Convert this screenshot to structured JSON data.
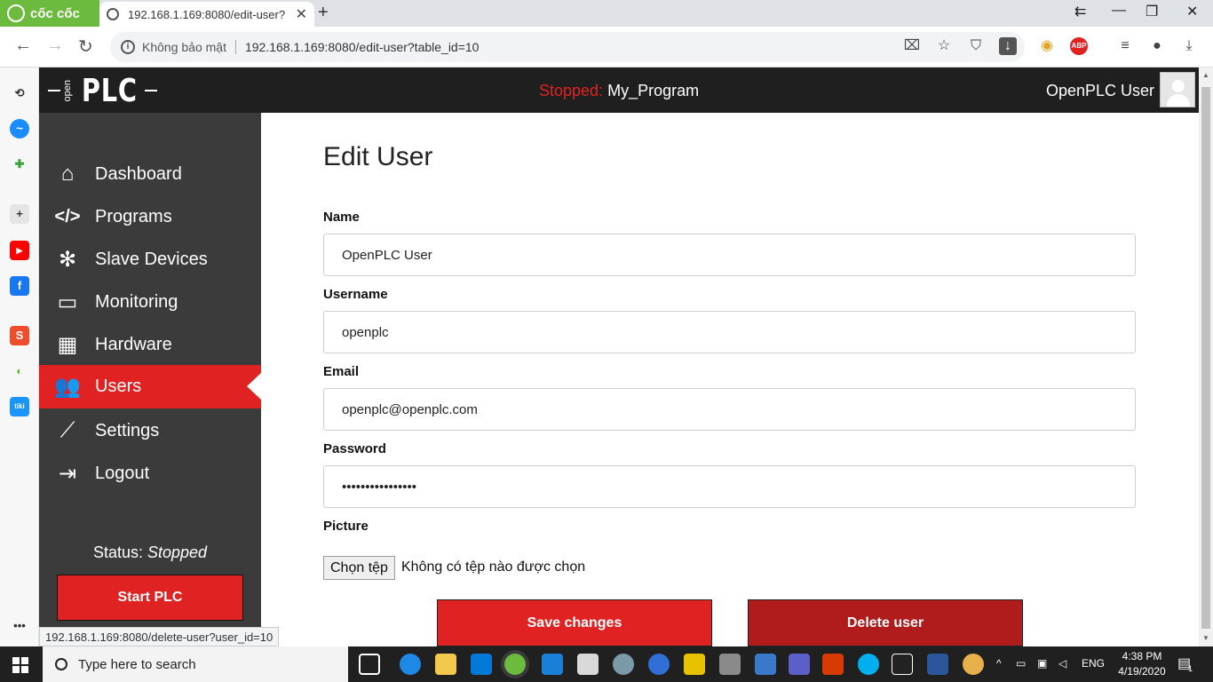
{
  "browser": {
    "brand": "cốc cốc",
    "tab_title": "192.168.1.169:8080/edit-user?",
    "security_label": "Không bảo mật",
    "url": "192.168.1.169:8080/edit-user?table_id=10",
    "status_url": "192.168.1.169:8080/delete-user?user_id=10"
  },
  "header": {
    "status_prefix": "Stopped:",
    "program_name": "My_Program",
    "user_name": "OpenPLC User"
  },
  "sidebar": {
    "items": [
      {
        "label": "Dashboard",
        "icon": "home-icon"
      },
      {
        "label": "Programs",
        "icon": "code-icon"
      },
      {
        "label": "Slave Devices",
        "icon": "network-icon"
      },
      {
        "label": "Monitoring",
        "icon": "laptop-icon"
      },
      {
        "label": "Hardware",
        "icon": "chip-icon"
      },
      {
        "label": "Users",
        "icon": "users-icon"
      },
      {
        "label": "Settings",
        "icon": "wrench-icon"
      },
      {
        "label": "Logout",
        "icon": "logout-icon"
      }
    ],
    "status_label": "Status:",
    "status_value": "Stopped",
    "start_button": "Start PLC"
  },
  "form": {
    "title": "Edit User",
    "name_label": "Name",
    "name_value": "OpenPLC User",
    "username_label": "Username",
    "username_value": "openplc",
    "email_label": "Email",
    "email_value": "openplc@openplc.com",
    "password_label": "Password",
    "password_value": "••••••••••••••••",
    "picture_label": "Picture",
    "file_button": "Chọn tệp",
    "file_status": "Không có tệp nào được chọn",
    "save_button": "Save changes",
    "delete_button": "Delete user"
  },
  "taskbar": {
    "search_placeholder": "Type here to search",
    "language": "ENG",
    "time": "4:38 PM",
    "date": "4/19/2020",
    "notification_count": "1"
  },
  "colors": {
    "accent_red": "#e02222",
    "delete_red": "#b01b1b",
    "header_dark": "#1f1f1f",
    "sidebar_dark": "#3b3b3b",
    "coccoc_green": "#6dbb3e"
  }
}
